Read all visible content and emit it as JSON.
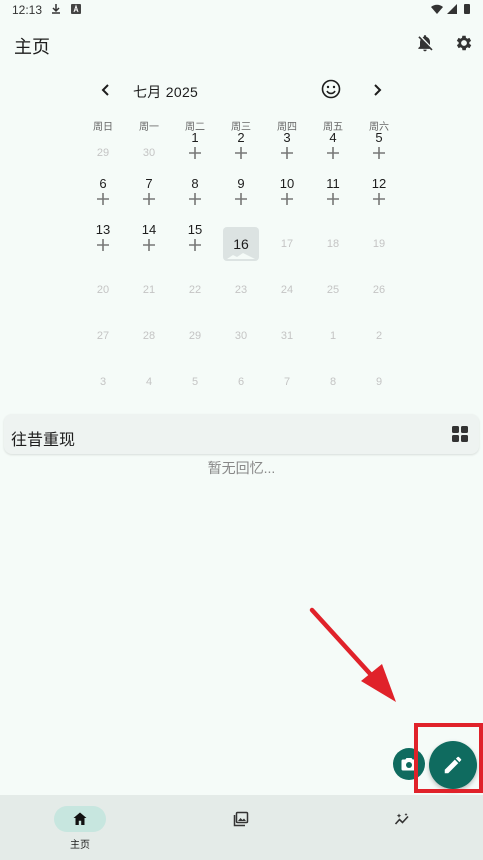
{
  "status_bar": {
    "time": "12:13"
  },
  "app_bar": {
    "title": "主页",
    "icons": [
      "notifications-off-icon",
      "settings-icon"
    ]
  },
  "calendar": {
    "month_label": "七月 2025",
    "weekdays": [
      "周日",
      "周一",
      "周二",
      "周三",
      "周四",
      "周五",
      "周六"
    ],
    "today": 16,
    "weeks": [
      [
        {
          "d": "29",
          "t": "faint"
        },
        {
          "d": "30",
          "t": "faint"
        },
        {
          "d": "1",
          "t": "add"
        },
        {
          "d": "2",
          "t": "add"
        },
        {
          "d": "3",
          "t": "add"
        },
        {
          "d": "4",
          "t": "add"
        },
        {
          "d": "5",
          "t": "add"
        }
      ],
      [
        {
          "d": "6",
          "t": "add"
        },
        {
          "d": "7",
          "t": "add"
        },
        {
          "d": "8",
          "t": "add"
        },
        {
          "d": "9",
          "t": "add"
        },
        {
          "d": "10",
          "t": "add"
        },
        {
          "d": "11",
          "t": "add"
        },
        {
          "d": "12",
          "t": "add"
        }
      ],
      [
        {
          "d": "13",
          "t": "add"
        },
        {
          "d": "14",
          "t": "add"
        },
        {
          "d": "15",
          "t": "add"
        },
        {
          "d": "16",
          "t": "today"
        },
        {
          "d": "17",
          "t": "faint"
        },
        {
          "d": "18",
          "t": "faint"
        },
        {
          "d": "19",
          "t": "faint"
        }
      ],
      [
        {
          "d": "20",
          "t": "faint"
        },
        {
          "d": "21",
          "t": "faint"
        },
        {
          "d": "22",
          "t": "faint"
        },
        {
          "d": "23",
          "t": "faint"
        },
        {
          "d": "24",
          "t": "faint"
        },
        {
          "d": "25",
          "t": "faint"
        },
        {
          "d": "26",
          "t": "faint"
        }
      ],
      [
        {
          "d": "27",
          "t": "faint"
        },
        {
          "d": "28",
          "t": "faint"
        },
        {
          "d": "29",
          "t": "faint"
        },
        {
          "d": "30",
          "t": "faint"
        },
        {
          "d": "31",
          "t": "faint"
        },
        {
          "d": "1",
          "t": "faint"
        },
        {
          "d": "2",
          "t": "faint"
        }
      ],
      [
        {
          "d": "3",
          "t": "faint"
        },
        {
          "d": "4",
          "t": "faint"
        },
        {
          "d": "5",
          "t": "faint"
        },
        {
          "d": "6",
          "t": "faint"
        },
        {
          "d": "7",
          "t": "faint"
        },
        {
          "d": "8",
          "t": "faint"
        },
        {
          "d": "9",
          "t": "faint"
        }
      ]
    ]
  },
  "memories": {
    "title": "往昔重现",
    "empty_text": "暂无回忆..."
  },
  "fabs": {
    "camera_icon": "camera-icon",
    "edit_icon": "edit-icon"
  },
  "bottom_nav": {
    "items": [
      {
        "icon": "home-icon",
        "label": "主页",
        "active": true
      },
      {
        "icon": "photo-library-icon",
        "label": "",
        "active": false
      },
      {
        "icon": "insights-icon",
        "label": "",
        "active": false
      }
    ]
  },
  "colors": {
    "background": "#f5fbf8",
    "accent": "#0f6b5f",
    "nav_bg": "#e4ebe8",
    "nav_active": "#c7e6df",
    "annotation_red": "#e0222a"
  }
}
